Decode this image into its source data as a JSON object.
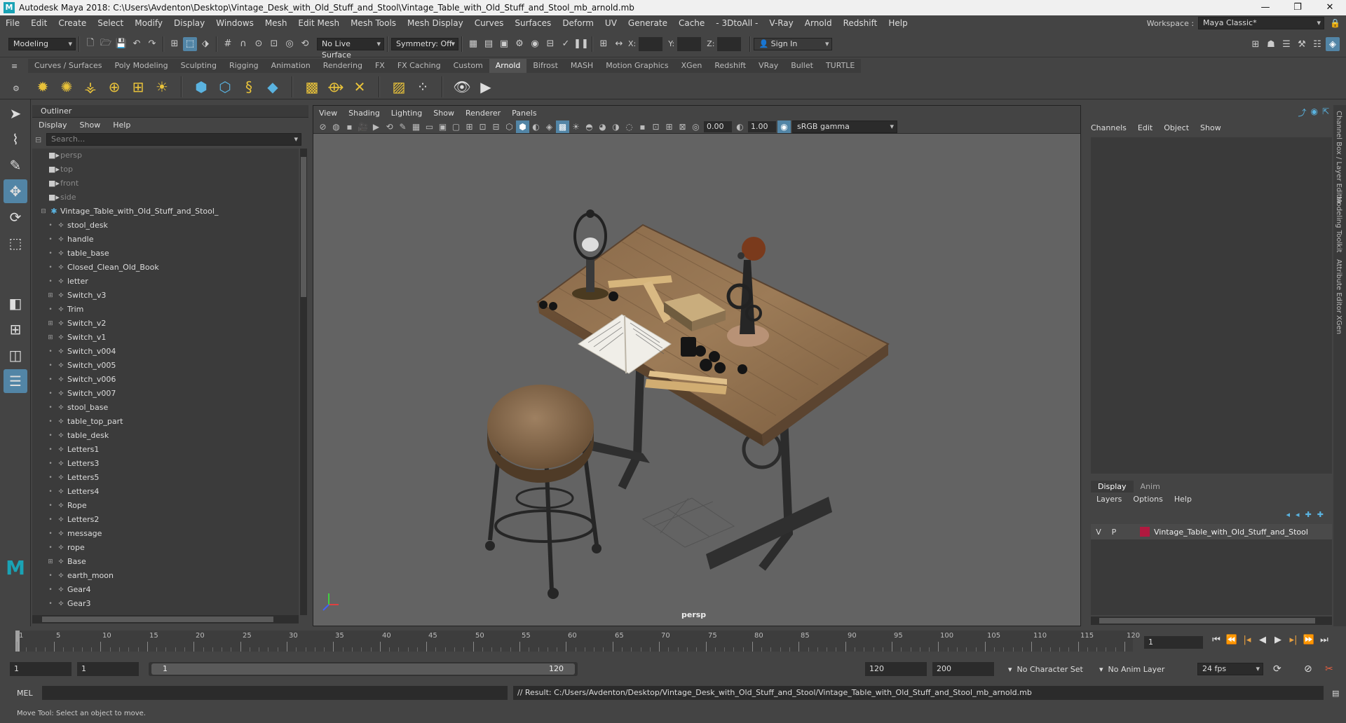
{
  "window": {
    "title": "Autodesk Maya 2018: C:\\Users\\Avdenton\\Desktop\\Vintage_Desk_with_Old_Stuff_and_Stool\\Vintage_Table_with_Old_Stuff_and_Stool_mb_arnold.mb"
  },
  "menu": [
    "File",
    "Edit",
    "Create",
    "Select",
    "Modify",
    "Display",
    "Windows",
    "Mesh",
    "Edit Mesh",
    "Mesh Tools",
    "Mesh Display",
    "Curves",
    "Surfaces",
    "Deform",
    "UV",
    "Generate",
    "Cache",
    "- 3DtoAll -",
    "V-Ray",
    "Arnold",
    "Redshift",
    "Help"
  ],
  "workspace": {
    "label": "Workspace :",
    "value": "Maya Classic*"
  },
  "status": {
    "mode": "Modeling",
    "live_surface": "No Live Surface",
    "symmetry": "Symmetry: Off",
    "x_label": "X:",
    "y_label": "Y:",
    "z_label": "Z:",
    "sign_in": "Sign In"
  },
  "shelf_tabs": [
    "Curves / Surfaces",
    "Poly Modeling",
    "Sculpting",
    "Rigging",
    "Animation",
    "Rendering",
    "FX",
    "FX Caching",
    "Custom",
    "Arnold",
    "Bifrost",
    "MASH",
    "Motion Graphics",
    "XGen",
    "Redshift",
    "VRay",
    "Bullet",
    "TURTLE"
  ],
  "active_shelf": "Arnold",
  "outliner": {
    "title": "Outliner",
    "menu": [
      "Display",
      "Show",
      "Help"
    ],
    "search_placeholder": "Search...",
    "cameras": [
      "persp",
      "top",
      "front",
      "side"
    ],
    "root": "Vintage_Table_with_Old_Stuff_and_Stool_",
    "items": [
      {
        "name": "stool_desk",
        "expand": false
      },
      {
        "name": "handle",
        "expand": false
      },
      {
        "name": "table_base",
        "expand": false
      },
      {
        "name": "Closed_Clean_Old_Book",
        "expand": false
      },
      {
        "name": "letter",
        "expand": false
      },
      {
        "name": "Switch_v3",
        "expand": true
      },
      {
        "name": "Trim",
        "expand": false
      },
      {
        "name": "Switch_v2",
        "expand": true
      },
      {
        "name": "Switch_v1",
        "expand": true
      },
      {
        "name": "Switch_v004",
        "expand": false
      },
      {
        "name": "Switch_v005",
        "expand": false
      },
      {
        "name": "Switch_v006",
        "expand": false
      },
      {
        "name": "Switch_v007",
        "expand": false
      },
      {
        "name": "stool_base",
        "expand": false
      },
      {
        "name": "table_top_part",
        "expand": false
      },
      {
        "name": "table_desk",
        "expand": false
      },
      {
        "name": "Letters1",
        "expand": false
      },
      {
        "name": "Letters3",
        "expand": false
      },
      {
        "name": "Letters5",
        "expand": false
      },
      {
        "name": "Letters4",
        "expand": false
      },
      {
        "name": "Rope",
        "expand": false
      },
      {
        "name": "Letters2",
        "expand": false
      },
      {
        "name": "message",
        "expand": false
      },
      {
        "name": "rope",
        "expand": false
      },
      {
        "name": "Base",
        "expand": true
      },
      {
        "name": "earth_moon",
        "expand": false
      },
      {
        "name": "Gear4",
        "expand": false
      },
      {
        "name": "Gear3",
        "expand": false
      }
    ]
  },
  "viewport": {
    "menu": [
      "View",
      "Shading",
      "Lighting",
      "Show",
      "Renderer",
      "Panels"
    ],
    "exposure": "0.00",
    "gamma": "1.00",
    "color_space": "sRGB gamma",
    "camera_label": "persp"
  },
  "channel_box": {
    "menu": [
      "Channels",
      "Edit",
      "Object",
      "Show"
    ],
    "layer_tabs": [
      "Display",
      "Anim"
    ],
    "layer_menu": [
      "Layers",
      "Options",
      "Help"
    ],
    "layer": {
      "v": "V",
      "p": "P",
      "name": "Vintage_Table_with_Old_Stuff_and_Stool"
    }
  },
  "side_tabs": [
    "Channel Box / Layer Editor",
    "Modeling Toolkit",
    "Attribute Editor",
    "XGen"
  ],
  "timeline": {
    "ticks": [
      1,
      5,
      10,
      15,
      20,
      25,
      30,
      35,
      40,
      45,
      50,
      55,
      60,
      65,
      70,
      75,
      80,
      85,
      90,
      95,
      100,
      105,
      110,
      115,
      120
    ],
    "current": "1"
  },
  "range": {
    "start": "1",
    "anim_start": "1",
    "slider_start": "1",
    "slider_end": "120",
    "end": "120",
    "anim_end": "200",
    "character_set": "No Character Set",
    "anim_layer": "No Anim Layer",
    "fps": "24 fps"
  },
  "cmd": {
    "lang": "MEL",
    "result": "// Result: C:/Users/Avdenton/Desktop/Vintage_Desk_with_Old_Stuff_and_Stool/Vintage_Table_with_Old_Stuff_and_Stool_mb_arnold.mb"
  },
  "help_line": "Move Tool: Select an object to move."
}
